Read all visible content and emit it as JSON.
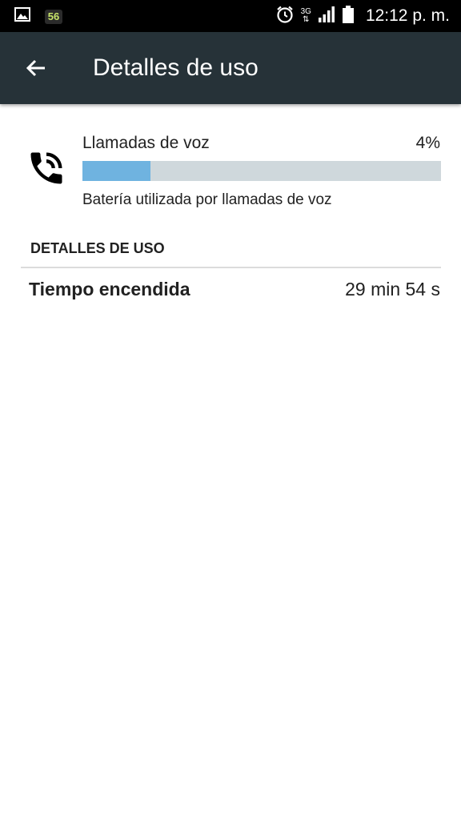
{
  "status_bar": {
    "notification_badge": "56",
    "network_type": "3G",
    "time": "12:12 p. m.",
    "icons": [
      "gallery-icon",
      "app-56-icon",
      "alarm-icon",
      "3g-data-icon",
      "signal-icon",
      "battery-icon"
    ]
  },
  "app_bar": {
    "title": "Detalles de uso",
    "background": "#263238",
    "back_icon": "arrow-back-icon"
  },
  "usage_item": {
    "icon": "phone-in-talk-icon",
    "label": "Llamadas de voz",
    "percent_label": "4%",
    "bar_fill_fraction": 0.19,
    "bar_color": "#6fb3e0",
    "track_color": "#cfd8dc",
    "summary": "Batería utilizada por llamadas de voz"
  },
  "details": {
    "header": "DETALLES DE USO",
    "rows": [
      {
        "label": "Tiempo encendida",
        "value": "29 min 54 s"
      }
    ]
  }
}
